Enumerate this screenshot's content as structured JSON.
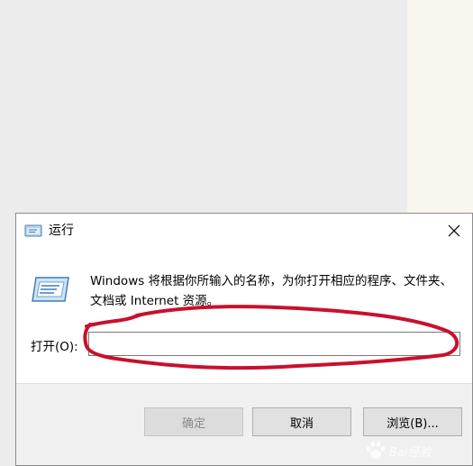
{
  "dialog": {
    "title": "运行",
    "description": "Windows 将根据你所输入的名称，为你打开相应的程序、文件夹、文档或 Internet 资源。",
    "open_label": "打开(O):",
    "open_value": "",
    "buttons": {
      "ok": "确定",
      "cancel": "取消",
      "browse": "浏览(B)..."
    },
    "icons": {
      "title": "run-window-icon",
      "close": "close-icon",
      "run": "run-program-icon"
    }
  },
  "annotation": {
    "color": "#c8102e"
  },
  "watermark": {
    "text": "Bai经验",
    "icon": "baidu-paw-icon"
  },
  "colors": {
    "background": "#ececec",
    "dialog": "#ffffff",
    "footer": "#f0f0f0"
  }
}
